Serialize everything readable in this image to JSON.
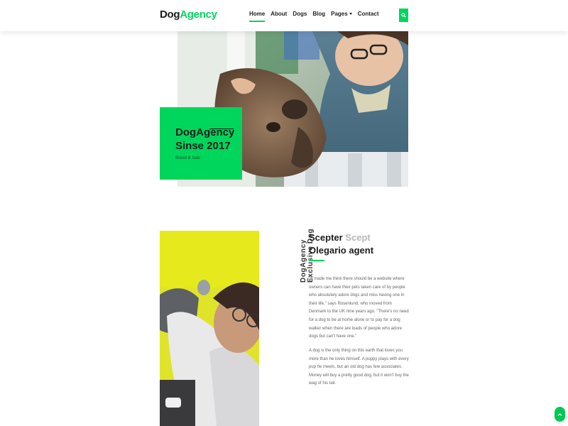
{
  "header": {
    "logo_part1": "Dog",
    "logo_part2": "Agency",
    "nav": [
      {
        "label": "Home"
      },
      {
        "label": "About"
      },
      {
        "label": "Dogs"
      },
      {
        "label": "Blog"
      },
      {
        "label": "Pages"
      },
      {
        "label": "Contact"
      }
    ],
    "search_icon": "search-icon"
  },
  "hero": {
    "title_line1": "DogAgency",
    "title_line2": "Sinse 2017",
    "subtitle": "Breed & Sale"
  },
  "about": {
    "vertical_line1": "DogAgency",
    "vertical_line2": "Exclusive Dog",
    "heading_1": "Scepter ",
    "heading_2": "Scept",
    "heading_3": " Olegario agent",
    "paragraph1": "\"It made me think there should be a website where owners can have their pets taken care of by people who absolutely adore dogs and miss having one in their life,\" says Rosenlund, who moved from Denmark to the UK nine years ago. \"There's no need for a dog to be at home alone or to pay for a dog walker when there are loads of people who adore dogs but can't have one.\"",
    "paragraph2": "A dog is the only thing on this earth that loves you more than he loves himself. A puppy plays with every pup he meets, but an old dog has few associates. Money will buy a pretty good dog, but it won't buy the wag of his tail."
  },
  "colors": {
    "accent": "#00d65c",
    "text": "#1c1c1c",
    "muted": "#666666"
  },
  "scroll_top_icon": "chevron-up-icon"
}
